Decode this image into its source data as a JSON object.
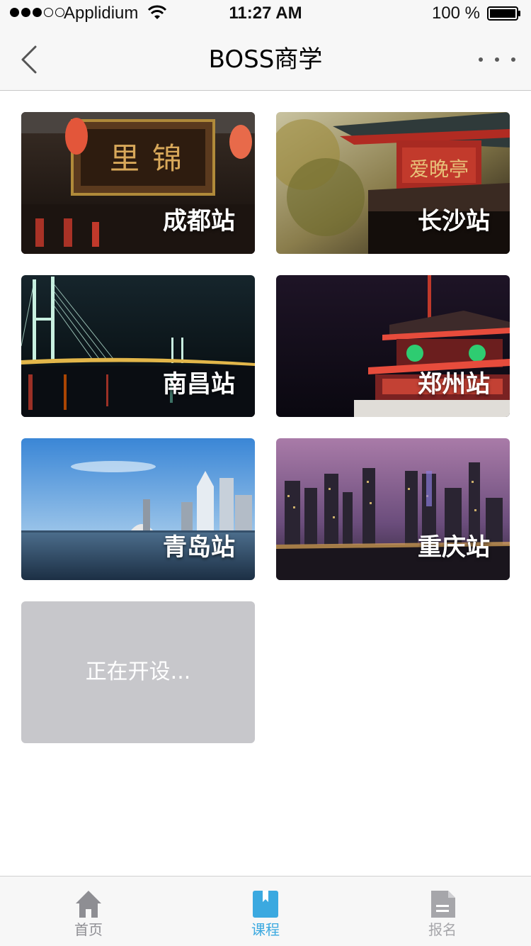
{
  "status_bar": {
    "carrier": "Applidium",
    "time": "11:27 AM",
    "battery": "100 %"
  },
  "nav": {
    "title": "BOSS商学",
    "back_icon": "chevron-left-icon",
    "more_icon": "more-dots-icon"
  },
  "cities": [
    {
      "label": "成都站",
      "scene": "gate-with-lanterns"
    },
    {
      "label": "长沙站",
      "scene": "pavilion-red-roof"
    },
    {
      "label": "南昌站",
      "scene": "bridge-at-night"
    },
    {
      "label": "郑州站",
      "scene": "pagoda-at-night"
    },
    {
      "label": "青岛站",
      "scene": "coastal-skyline"
    },
    {
      "label": "重庆站",
      "scene": "city-night-skyline"
    }
  ],
  "placeholder": {
    "label": "正在开设..."
  },
  "tabs": [
    {
      "label": "首页",
      "icon": "home-icon",
      "active": false
    },
    {
      "label": "课程",
      "icon": "bookmark-book-icon",
      "active": true
    },
    {
      "label": "报名",
      "icon": "document-icon",
      "active": false
    }
  ],
  "colors": {
    "accent": "#3ba9e0",
    "inactive": "#8e8e93",
    "placeholder_bg": "#c7c7cb"
  }
}
